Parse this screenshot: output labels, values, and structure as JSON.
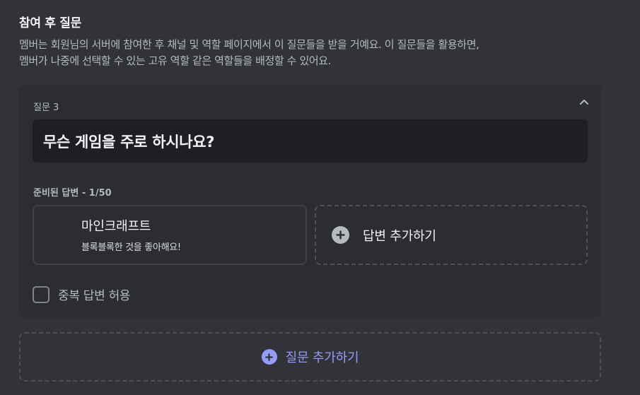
{
  "section": {
    "title": "참여 후 질문",
    "description_line1": "멤버는 회원님의 서버에 참여한 후 채널 및 역할 페이지에서 이 질문들을 받을 거예요. 이 질문들을 활용하면,",
    "description_line2": "멤버가 나중에 선택할 수 있는 고유 역할 같은 역할들을 배정할 수 있어요."
  },
  "question": {
    "label": "질문 3",
    "text": "무슨 게임을 주로 하시나요?",
    "collapse_icon": "chevron-up-icon",
    "answers_label": "준비된 답변 - 1/50",
    "answers": [
      {
        "title": "마인크래프트",
        "description": "블록블록한 것을 좋아해요!"
      }
    ],
    "add_answer_label": "답변 추가하기",
    "allow_multiple_label": "중복 답변 허용",
    "allow_multiple_checked": false
  },
  "add_question_label": "질문 추가하기",
  "colors": {
    "background": "#313338",
    "card": "#2b2d31",
    "input": "#1e1f22",
    "accent": "#949cf7"
  }
}
